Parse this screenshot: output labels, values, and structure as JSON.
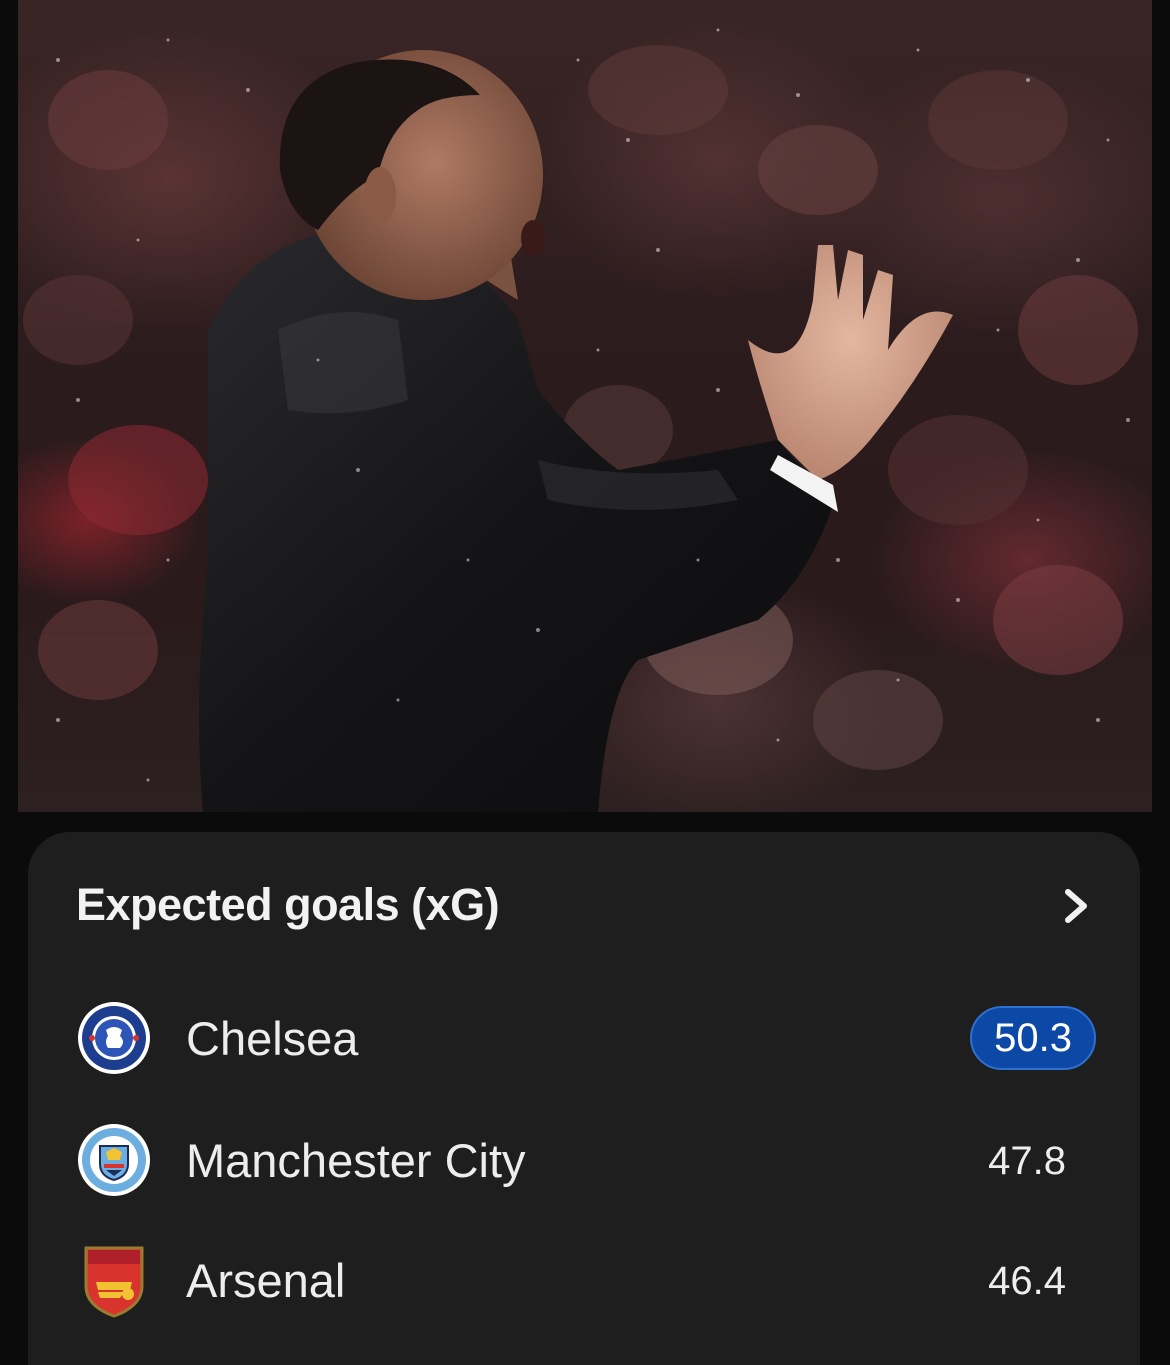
{
  "hero": {
    "image": "photo-manager-clapping-in-rain"
  },
  "xg_card": {
    "title": "Expected goals (xG)",
    "chevron_icon": "chevron-right-icon",
    "teams": [
      {
        "name": "Chelsea",
        "value": "50.3",
        "highlighted": true,
        "crest_icon": "chelsea-crest-icon"
      },
      {
        "name": "Manchester City",
        "value": "47.8",
        "highlighted": false,
        "crest_icon": "manchester-city-crest-icon"
      },
      {
        "name": "Arsenal",
        "value": "46.4",
        "highlighted": false,
        "crest_icon": "arsenal-crest-icon"
      }
    ]
  },
  "colors": {
    "card_background": "#1e1e1f",
    "highlight_badge": "#0c49a6",
    "text": "#ededed"
  }
}
